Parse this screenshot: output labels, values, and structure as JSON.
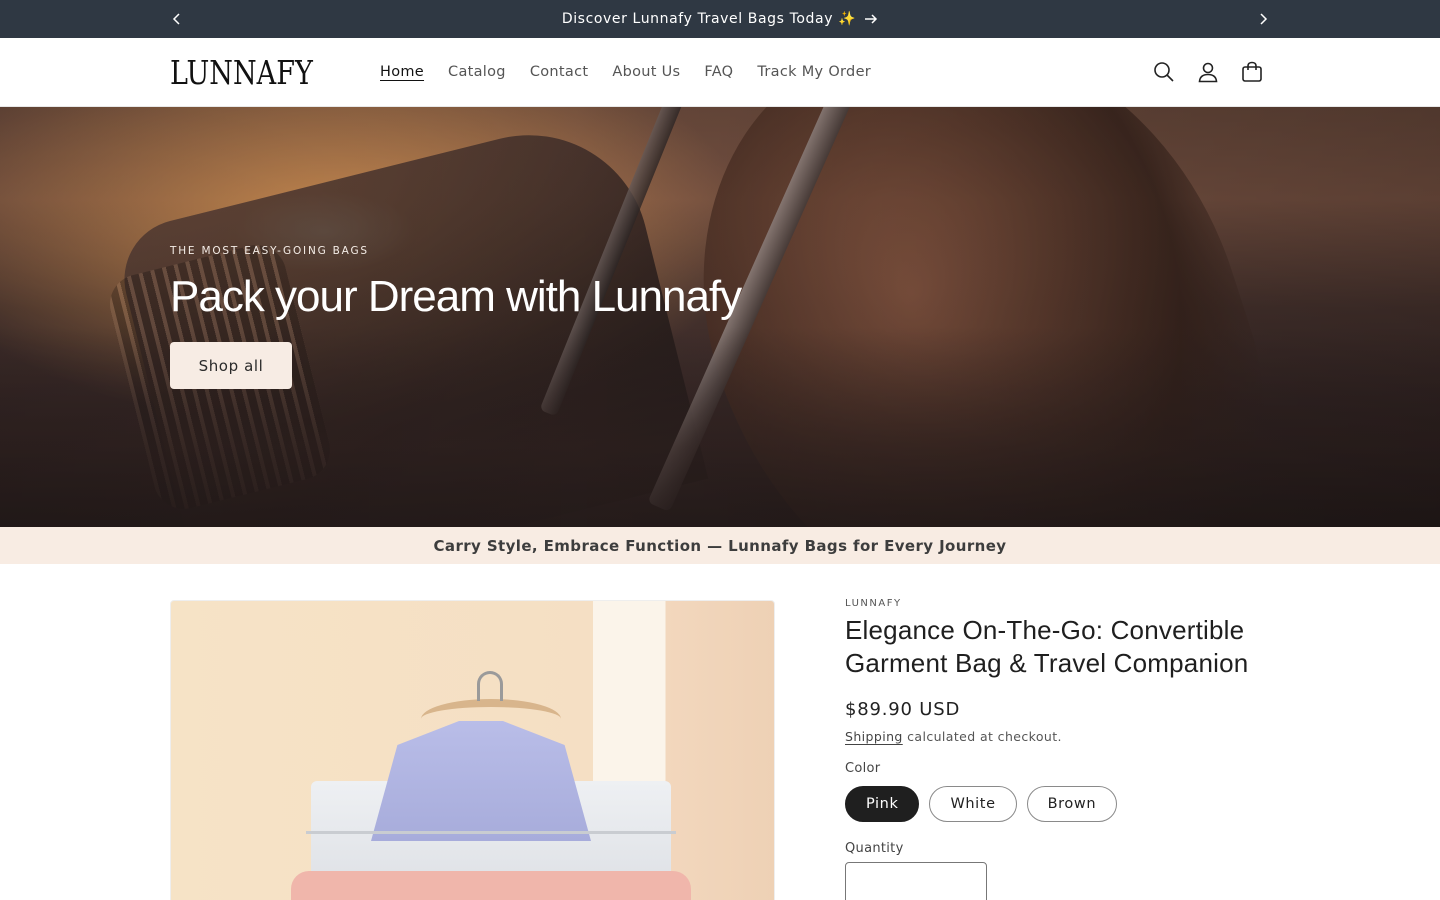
{
  "announcement": {
    "message": "Discover Lunnafy Travel Bags Today ✨",
    "bg_color": "#2f3843"
  },
  "header": {
    "logo": "LUNNAFY",
    "nav": [
      {
        "label": "Home",
        "active": true
      },
      {
        "label": "Catalog"
      },
      {
        "label": "Contact"
      },
      {
        "label": "About Us"
      },
      {
        "label": "FAQ"
      },
      {
        "label": "Track My Order"
      }
    ],
    "icons": [
      "search-icon",
      "account-icon",
      "cart-icon"
    ]
  },
  "hero": {
    "eyebrow": "THE MOST EASY-GOING BAGS",
    "headline": "Pack your Dream with Lunnafy",
    "cta": "Shop all"
  },
  "strip": {
    "text": "Carry Style, Embrace Function — Lunnafy Bags for Every Journey",
    "bg_color": "#f8ece3"
  },
  "product": {
    "vendor": "LUNNAFY",
    "title": "Elegance On-The-Go: Convertible Garment Bag & Travel Companion",
    "price": "$89.90 USD",
    "shipping_link": "Shipping",
    "shipping_rest": " calculated at checkout.",
    "color_label": "Color",
    "colors": [
      {
        "label": "Pink",
        "selected": true
      },
      {
        "label": "White"
      },
      {
        "label": "Brown"
      }
    ],
    "quantity_label": "Quantity"
  }
}
